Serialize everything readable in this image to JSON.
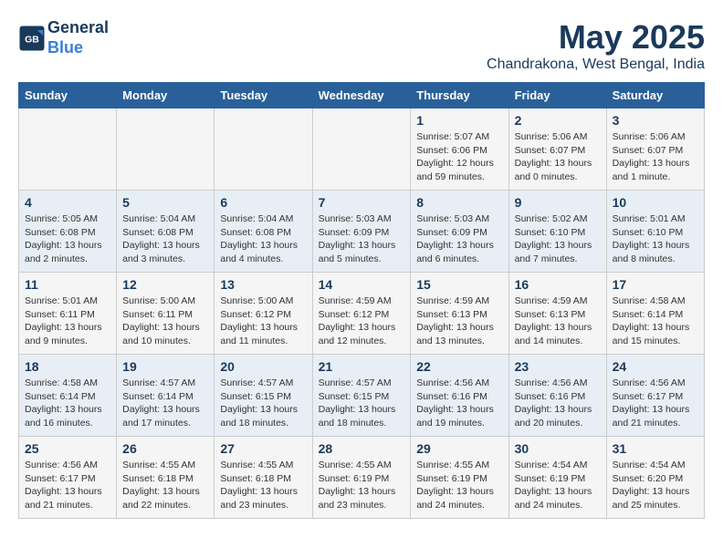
{
  "header": {
    "logo_line1": "General",
    "logo_line2": "Blue",
    "month_title": "May 2025",
    "location": "Chandrakona, West Bengal, India"
  },
  "weekdays": [
    "Sunday",
    "Monday",
    "Tuesday",
    "Wednesday",
    "Thursday",
    "Friday",
    "Saturday"
  ],
  "weeks": [
    [
      {
        "day": "",
        "info": ""
      },
      {
        "day": "",
        "info": ""
      },
      {
        "day": "",
        "info": ""
      },
      {
        "day": "",
        "info": ""
      },
      {
        "day": "1",
        "info": "Sunrise: 5:07 AM\nSunset: 6:06 PM\nDaylight: 12 hours and 59 minutes."
      },
      {
        "day": "2",
        "info": "Sunrise: 5:06 AM\nSunset: 6:07 PM\nDaylight: 13 hours and 0 minutes."
      },
      {
        "day": "3",
        "info": "Sunrise: 5:06 AM\nSunset: 6:07 PM\nDaylight: 13 hours and 1 minute."
      }
    ],
    [
      {
        "day": "4",
        "info": "Sunrise: 5:05 AM\nSunset: 6:08 PM\nDaylight: 13 hours and 2 minutes."
      },
      {
        "day": "5",
        "info": "Sunrise: 5:04 AM\nSunset: 6:08 PM\nDaylight: 13 hours and 3 minutes."
      },
      {
        "day": "6",
        "info": "Sunrise: 5:04 AM\nSunset: 6:08 PM\nDaylight: 13 hours and 4 minutes."
      },
      {
        "day": "7",
        "info": "Sunrise: 5:03 AM\nSunset: 6:09 PM\nDaylight: 13 hours and 5 minutes."
      },
      {
        "day": "8",
        "info": "Sunrise: 5:03 AM\nSunset: 6:09 PM\nDaylight: 13 hours and 6 minutes."
      },
      {
        "day": "9",
        "info": "Sunrise: 5:02 AM\nSunset: 6:10 PM\nDaylight: 13 hours and 7 minutes."
      },
      {
        "day": "10",
        "info": "Sunrise: 5:01 AM\nSunset: 6:10 PM\nDaylight: 13 hours and 8 minutes."
      }
    ],
    [
      {
        "day": "11",
        "info": "Sunrise: 5:01 AM\nSunset: 6:11 PM\nDaylight: 13 hours and 9 minutes."
      },
      {
        "day": "12",
        "info": "Sunrise: 5:00 AM\nSunset: 6:11 PM\nDaylight: 13 hours and 10 minutes."
      },
      {
        "day": "13",
        "info": "Sunrise: 5:00 AM\nSunset: 6:12 PM\nDaylight: 13 hours and 11 minutes."
      },
      {
        "day": "14",
        "info": "Sunrise: 4:59 AM\nSunset: 6:12 PM\nDaylight: 13 hours and 12 minutes."
      },
      {
        "day": "15",
        "info": "Sunrise: 4:59 AM\nSunset: 6:13 PM\nDaylight: 13 hours and 13 minutes."
      },
      {
        "day": "16",
        "info": "Sunrise: 4:59 AM\nSunset: 6:13 PM\nDaylight: 13 hours and 14 minutes."
      },
      {
        "day": "17",
        "info": "Sunrise: 4:58 AM\nSunset: 6:14 PM\nDaylight: 13 hours and 15 minutes."
      }
    ],
    [
      {
        "day": "18",
        "info": "Sunrise: 4:58 AM\nSunset: 6:14 PM\nDaylight: 13 hours and 16 minutes."
      },
      {
        "day": "19",
        "info": "Sunrise: 4:57 AM\nSunset: 6:14 PM\nDaylight: 13 hours and 17 minutes."
      },
      {
        "day": "20",
        "info": "Sunrise: 4:57 AM\nSunset: 6:15 PM\nDaylight: 13 hours and 18 minutes."
      },
      {
        "day": "21",
        "info": "Sunrise: 4:57 AM\nSunset: 6:15 PM\nDaylight: 13 hours and 18 minutes."
      },
      {
        "day": "22",
        "info": "Sunrise: 4:56 AM\nSunset: 6:16 PM\nDaylight: 13 hours and 19 minutes."
      },
      {
        "day": "23",
        "info": "Sunrise: 4:56 AM\nSunset: 6:16 PM\nDaylight: 13 hours and 20 minutes."
      },
      {
        "day": "24",
        "info": "Sunrise: 4:56 AM\nSunset: 6:17 PM\nDaylight: 13 hours and 21 minutes."
      }
    ],
    [
      {
        "day": "25",
        "info": "Sunrise: 4:56 AM\nSunset: 6:17 PM\nDaylight: 13 hours and 21 minutes."
      },
      {
        "day": "26",
        "info": "Sunrise: 4:55 AM\nSunset: 6:18 PM\nDaylight: 13 hours and 22 minutes."
      },
      {
        "day": "27",
        "info": "Sunrise: 4:55 AM\nSunset: 6:18 PM\nDaylight: 13 hours and 23 minutes."
      },
      {
        "day": "28",
        "info": "Sunrise: 4:55 AM\nSunset: 6:19 PM\nDaylight: 13 hours and 23 minutes."
      },
      {
        "day": "29",
        "info": "Sunrise: 4:55 AM\nSunset: 6:19 PM\nDaylight: 13 hours and 24 minutes."
      },
      {
        "day": "30",
        "info": "Sunrise: 4:54 AM\nSunset: 6:19 PM\nDaylight: 13 hours and 24 minutes."
      },
      {
        "day": "31",
        "info": "Sunrise: 4:54 AM\nSunset: 6:20 PM\nDaylight: 13 hours and 25 minutes."
      }
    ]
  ]
}
